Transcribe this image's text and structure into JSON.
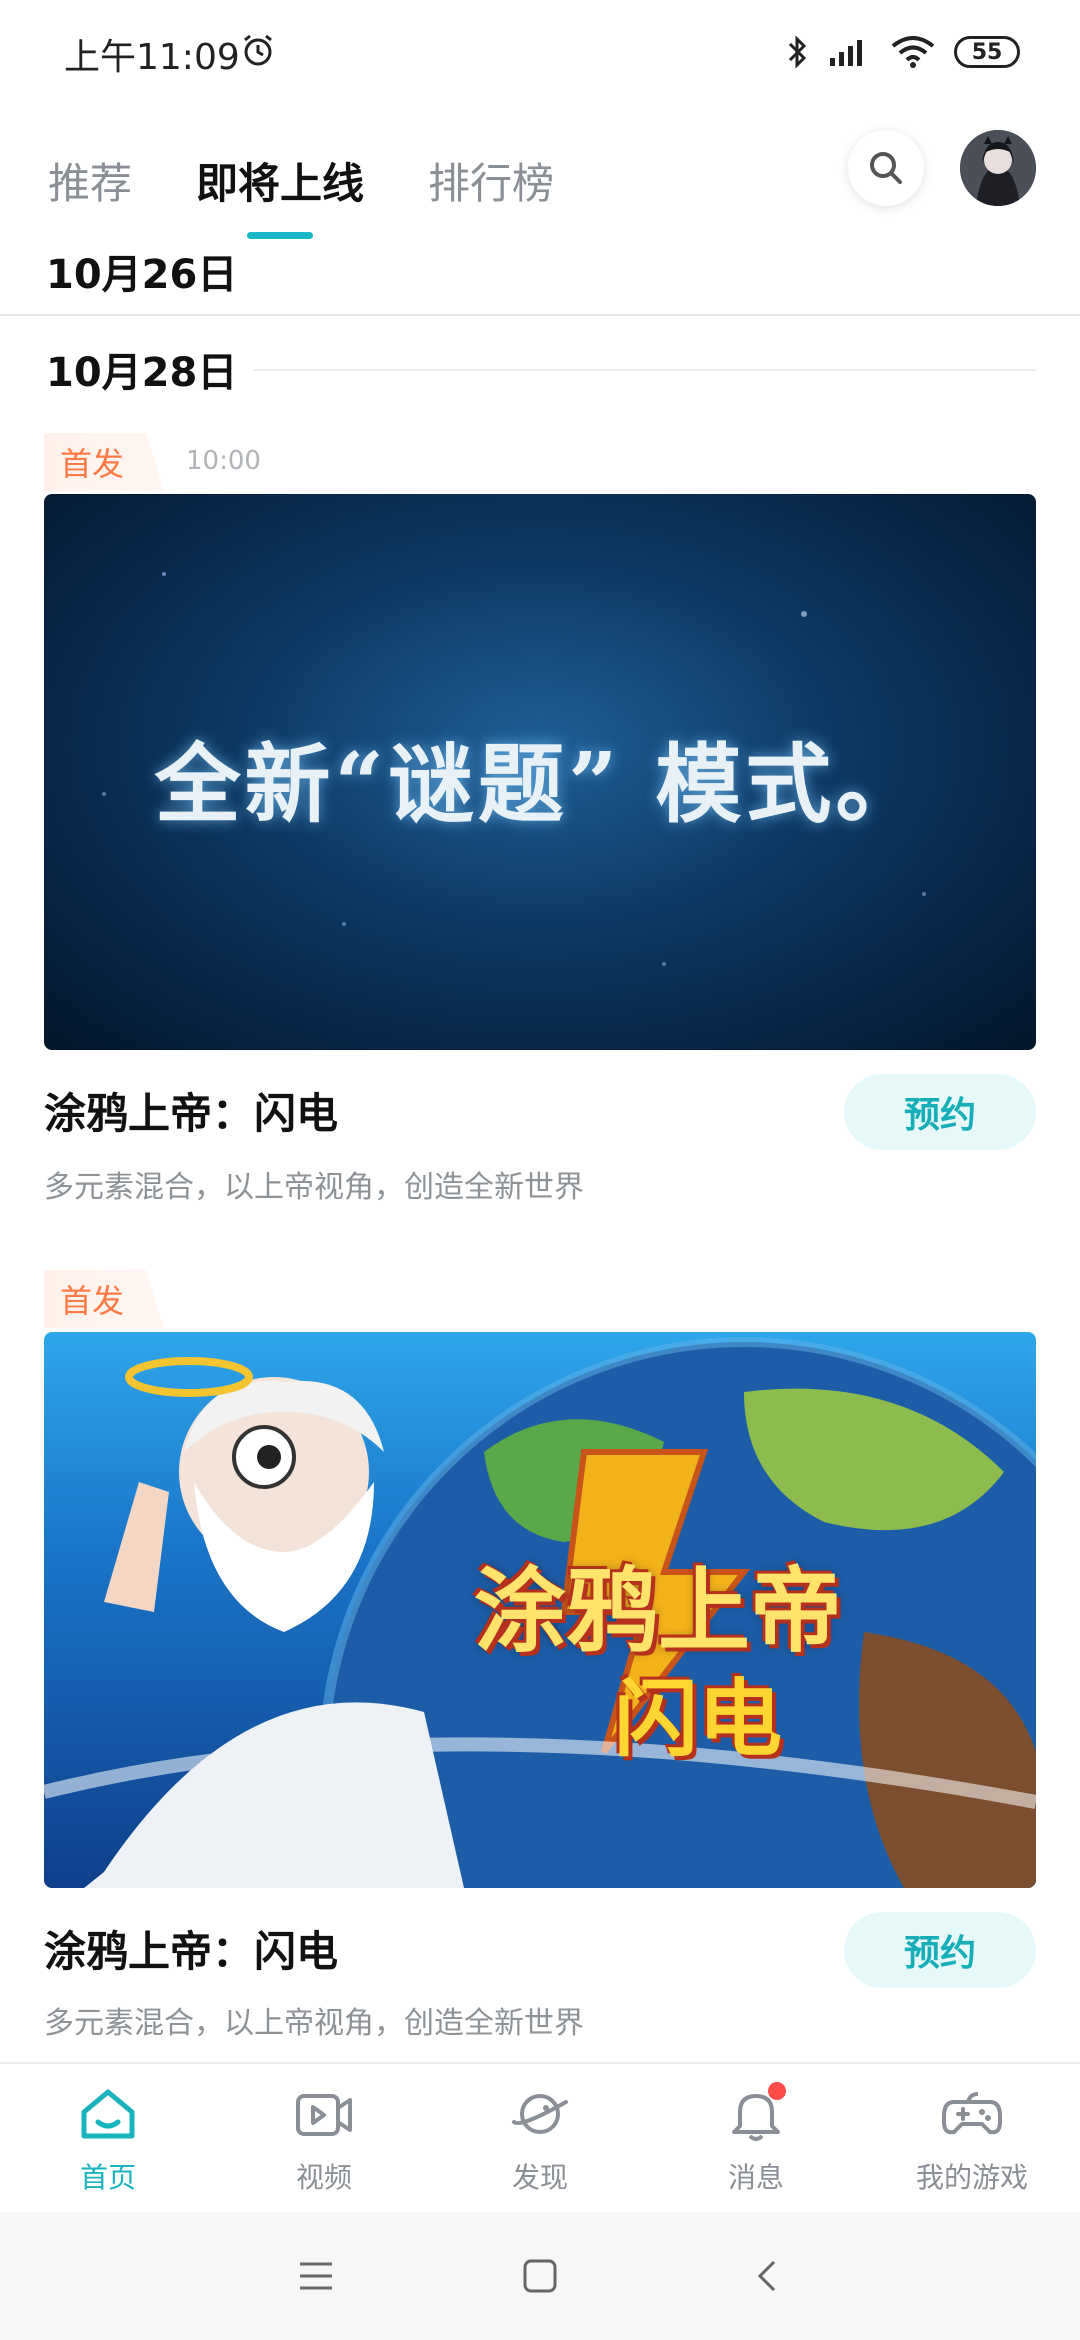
{
  "status_bar": {
    "time": "上午11:09",
    "battery": "55"
  },
  "tabs": [
    {
      "label": "推荐",
      "active": false
    },
    {
      "label": "即将上线",
      "active": true
    },
    {
      "label": "排行榜",
      "active": false
    }
  ],
  "dates": {
    "first": "10月26日",
    "second": "10月28日"
  },
  "cards": [
    {
      "badge": "首发",
      "time": "10:00",
      "banner_text": "全新“谜题” 模式。",
      "title": "涂鸦上帝：闪电",
      "desc": "多元素混合，以上帝视角，创造全新世界",
      "button": "预约"
    },
    {
      "badge": "首发",
      "banner_logo_line1": "涂鸦上帝",
      "banner_logo_line2": "闪电",
      "title": "涂鸦上帝：闪电",
      "desc": "多元素混合，以上帝视角，创造全新世界",
      "button": "预约"
    }
  ],
  "bottom_nav": [
    {
      "label": "首页",
      "icon": "home-icon",
      "active": true
    },
    {
      "label": "视频",
      "icon": "video-icon",
      "active": false
    },
    {
      "label": "发现",
      "icon": "discover-icon",
      "active": false
    },
    {
      "label": "消息",
      "icon": "bell-icon",
      "active": false
    },
    {
      "label": "我的游戏",
      "icon": "gamepad-icon",
      "active": false
    }
  ],
  "colors": {
    "accent": "#18b8c4",
    "badge": "#ff7a45",
    "notification": "#ff4a4a"
  }
}
